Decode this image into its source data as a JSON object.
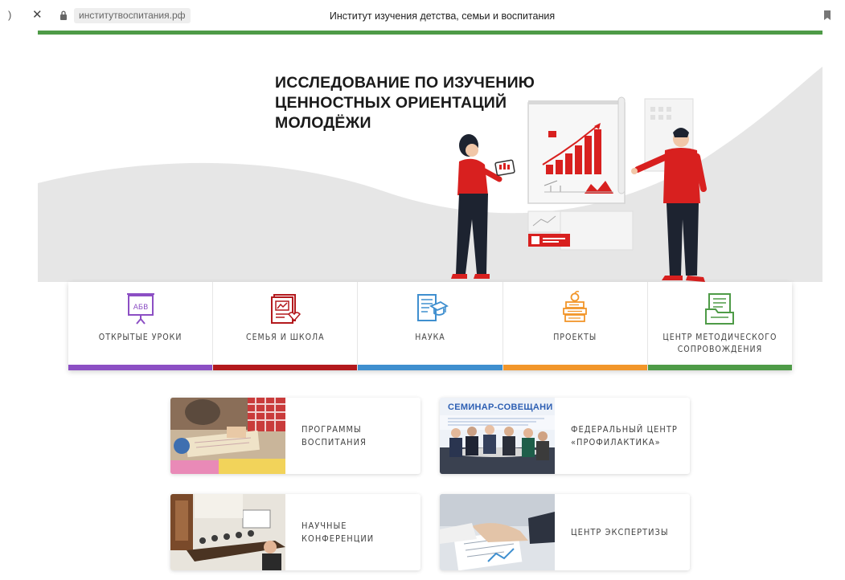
{
  "browser": {
    "url": "институтвоспитания.рф",
    "title": "Институт изучения детства, семьи и воспитания"
  },
  "colors": {
    "green": "#4e9b47",
    "purple": "#8c4fc4",
    "red": "#b3191d",
    "blue": "#3f8fcf",
    "orange": "#f2962a",
    "hero_red": "#d8201f"
  },
  "hero": {
    "title_lines": [
      "ИССЛЕДОВАНИЕ ПО ИЗУЧЕНИЮ",
      "ЦЕННОСТНЫХ ОРИЕНТАЦИЙ",
      "МОЛОДЁЖИ"
    ],
    "board_letters": "АБВ"
  },
  "categories": [
    {
      "label": "Открытые уроки",
      "icon": "presentation-board-icon",
      "color": "#8c4fc4"
    },
    {
      "label": "Семья и школа",
      "icon": "document-heart-icon",
      "color": "#b3191d"
    },
    {
      "label": "Наука",
      "icon": "book-graduation-cap-icon",
      "color": "#3f8fcf"
    },
    {
      "label": "Проекты",
      "icon": "books-apple-icon",
      "color": "#f2962a"
    },
    {
      "label_lines": [
        "Центр методического",
        "сопровождения"
      ],
      "icon": "document-folder-icon",
      "color": "#4e9b47"
    }
  ],
  "cards": [
    {
      "label_lines": [
        "Программы",
        "воспитания"
      ],
      "image": "classroom-children-photo"
    },
    {
      "label_lines": [
        "Федеральный центр",
        "«Профилактика»"
      ],
      "image": "seminar-meeting-photo",
      "image_caption": "СЕМИНАР-СОВЕЩАНИ"
    },
    {
      "label_lines": [
        "Научные конференции"
      ],
      "image": "conference-hall-photo"
    },
    {
      "label_lines": [
        "Центр экспертизы"
      ],
      "image": "documents-handshake-photo"
    }
  ]
}
